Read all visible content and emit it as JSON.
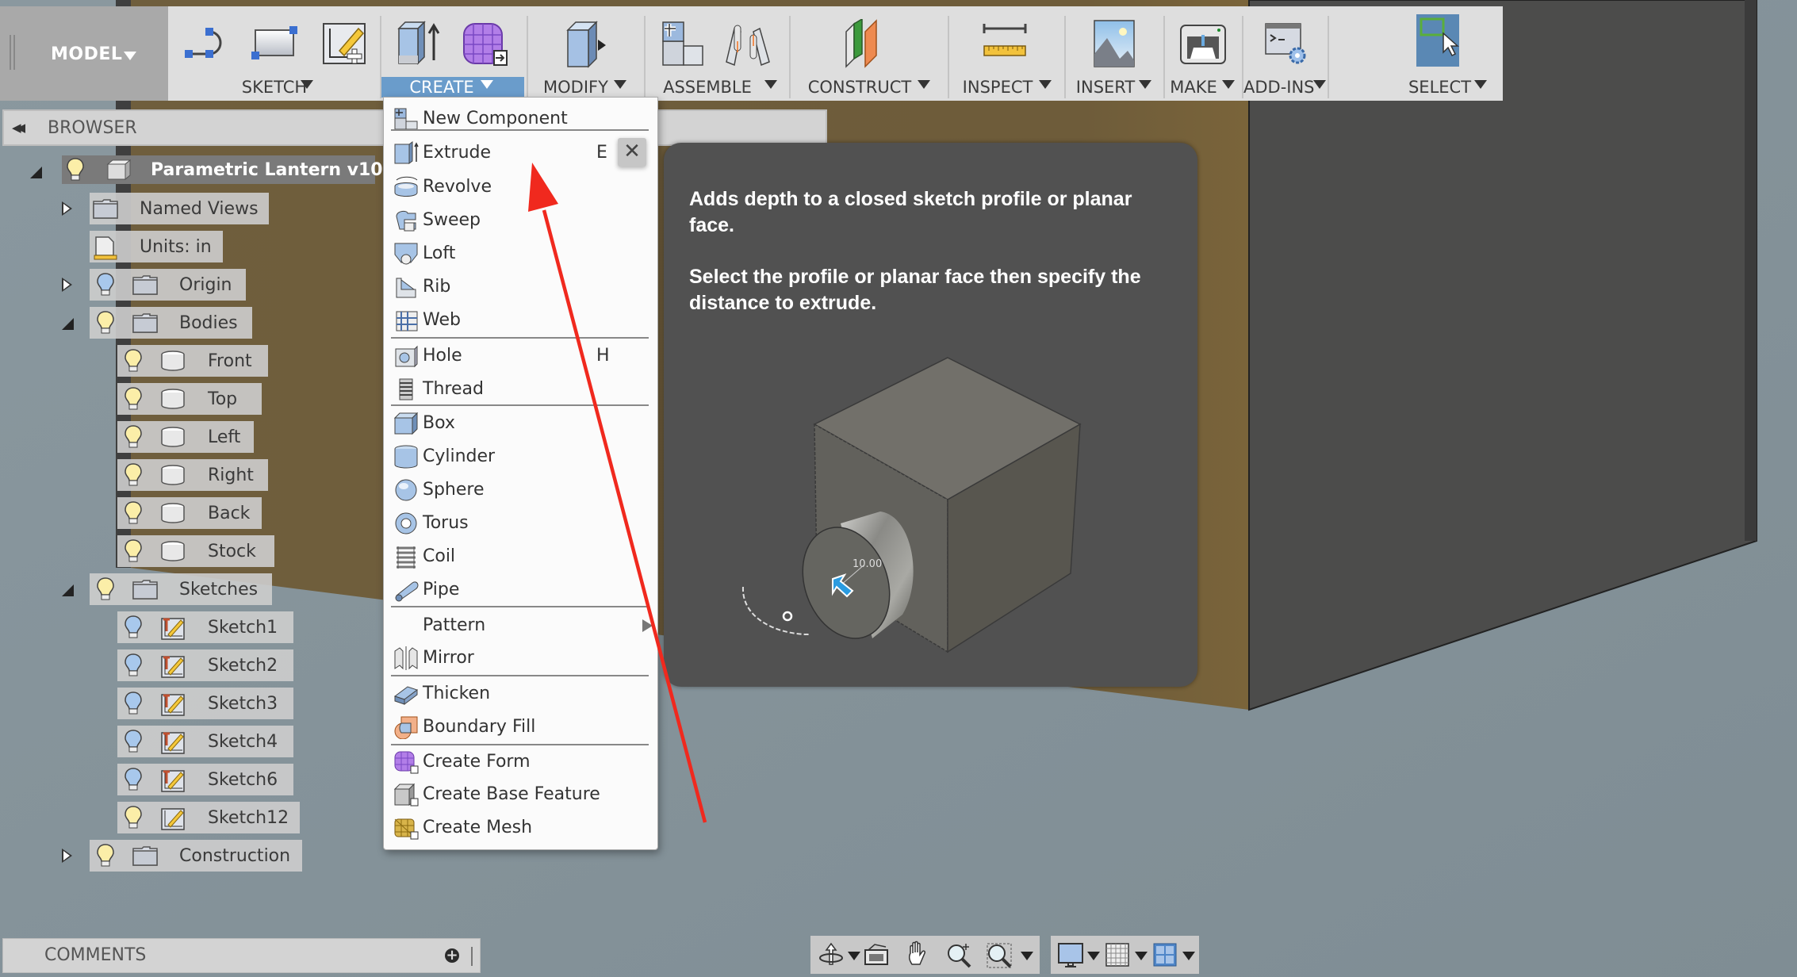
{
  "toolbar": {
    "workspace": "MODEL",
    "groups": [
      {
        "label": "SKETCH",
        "icons": [
          "arc-line-icon",
          "rectangle-icon",
          "create-sketch-icon"
        ]
      },
      {
        "label": "CREATE",
        "icons": [
          "extrude-icon",
          "create-form-icon"
        ],
        "active": true
      },
      {
        "label": "MODIFY",
        "icons": [
          "press-pull-icon"
        ]
      },
      {
        "label": "ASSEMBLE",
        "icons": [
          "new-component-icon",
          "joint-icon"
        ]
      },
      {
        "label": "CONSTRUCT",
        "icons": [
          "offset-plane-icon"
        ]
      },
      {
        "label": "INSPECT",
        "icons": [
          "measure-icon"
        ]
      },
      {
        "label": "INSERT",
        "icons": [
          "insert-image-icon"
        ]
      },
      {
        "label": "MAKE",
        "icons": [
          "3d-print-icon"
        ]
      },
      {
        "label": "ADD-INS",
        "icons": [
          "scripts-addins-icon"
        ]
      },
      {
        "label": "SELECT",
        "icons": [
          "select-window-icon"
        ]
      }
    ]
  },
  "browser": {
    "title": "BROWSER",
    "root": "Parametric Lantern v10",
    "nodes": [
      {
        "label": "Named Views",
        "expander": "closed"
      },
      {
        "label": "Units: in"
      },
      {
        "label": "Origin",
        "expander": "closed",
        "visible": "hidden"
      },
      {
        "label": "Bodies",
        "expander": "open",
        "visible": "on"
      },
      {
        "label": "Front",
        "visible": "on"
      },
      {
        "label": "Top",
        "visible": "on"
      },
      {
        "label": "Left",
        "visible": "on"
      },
      {
        "label": "Right",
        "visible": "on"
      },
      {
        "label": "Back",
        "visible": "on"
      },
      {
        "label": "Stock",
        "visible": "on"
      },
      {
        "label": "Sketches",
        "expander": "open",
        "visible": "on"
      },
      {
        "label": "Sketch1",
        "visible": "hidden"
      },
      {
        "label": "Sketch2",
        "visible": "hidden"
      },
      {
        "label": "Sketch3",
        "visible": "hidden"
      },
      {
        "label": "Sketch4",
        "visible": "hidden"
      },
      {
        "label": "Sketch6",
        "visible": "hidden"
      },
      {
        "label": "Sketch12",
        "visible": "on"
      },
      {
        "label": "Construction",
        "expander": "closed",
        "visible": "on"
      }
    ]
  },
  "create_menu": {
    "items": [
      {
        "label": "New Component",
        "icon": "new-component-icon"
      },
      {
        "label": "Extrude",
        "icon": "extrude-icon",
        "shortcut": "E"
      },
      {
        "label": "Revolve",
        "icon": "revolve-icon"
      },
      {
        "label": "Sweep",
        "icon": "sweep-icon"
      },
      {
        "label": "Loft",
        "icon": "loft-icon"
      },
      {
        "label": "Rib",
        "icon": "rib-icon"
      },
      {
        "label": "Web",
        "icon": "web-icon"
      },
      {
        "label": "Hole",
        "icon": "hole-icon",
        "shortcut": "H"
      },
      {
        "label": "Thread",
        "icon": "thread-icon"
      },
      {
        "label": "Box",
        "icon": "box-icon"
      },
      {
        "label": "Cylinder",
        "icon": "cylinder-icon"
      },
      {
        "label": "Sphere",
        "icon": "sphere-icon"
      },
      {
        "label": "Torus",
        "icon": "torus-icon"
      },
      {
        "label": "Coil",
        "icon": "coil-icon"
      },
      {
        "label": "Pipe",
        "icon": "pipe-icon"
      },
      {
        "label": "Pattern",
        "icon": "",
        "submenu": true
      },
      {
        "label": "Mirror",
        "icon": "mirror-icon"
      },
      {
        "label": "Thicken",
        "icon": "thicken-icon"
      },
      {
        "label": "Boundary Fill",
        "icon": "boundary-fill-icon"
      },
      {
        "label": "Create Form",
        "icon": "create-form-icon"
      },
      {
        "label": "Create Base Feature",
        "icon": "create-base-feature-icon"
      },
      {
        "label": "Create Mesh",
        "icon": "create-mesh-icon"
      }
    ],
    "close_label": "✕"
  },
  "tooltip": {
    "line1": "Adds depth to a closed sketch profile or planar face.",
    "line2": "Select the profile or planar face then specify the distance to extrude.",
    "preview_dimension": "10.00"
  },
  "comments": {
    "title": "COMMENTS",
    "add_label": "+"
  },
  "navbar": {
    "items": [
      "orbit-icon",
      "look-at-icon",
      "pan-icon",
      "zoom-icon",
      "zoom-window-icon",
      "display-settings-icon",
      "grid-icon",
      "viewports-icon"
    ]
  },
  "colors": {
    "accent": "#6a9ccb",
    "annotation_arrow": "#f0291e",
    "viewport_bg": "#84939a",
    "body_brown": "#705e3b",
    "body_dark": "#4c4c4b"
  }
}
